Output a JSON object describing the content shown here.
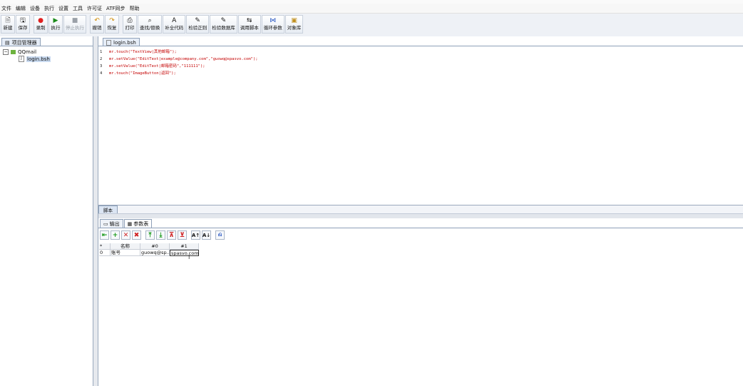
{
  "menu": [
    "文件",
    "编辑",
    "设备",
    "执行",
    "设置",
    "工具",
    "许可证",
    "ATF同步",
    "帮助"
  ],
  "toolbar": [
    {
      "label": "新建",
      "icon": "new-file-icon",
      "glyph": "🗎",
      "enabled": true
    },
    {
      "label": "保存",
      "icon": "save-icon",
      "glyph": "🖫",
      "enabled": true
    },
    {
      "label": "录制",
      "icon": "record-icon",
      "glyph": "●",
      "color": "#e02020",
      "enabled": true
    },
    {
      "label": "执行",
      "icon": "run-icon",
      "glyph": "▶",
      "color": "#1a8a1a",
      "enabled": true
    },
    {
      "label": "停止执行",
      "icon": "stop-icon",
      "glyph": "■",
      "enabled": false
    },
    {
      "label": "撤销",
      "icon": "undo-icon",
      "glyph": "↶",
      "color": "#d08a00",
      "enabled": true
    },
    {
      "label": "恢复",
      "icon": "redo-icon",
      "glyph": "↷",
      "color": "#d08a00",
      "enabled": true
    },
    {
      "label": "打印",
      "icon": "print-icon",
      "glyph": "⎙",
      "enabled": true
    },
    {
      "label": "查找/替换",
      "icon": "find-replace-icon",
      "glyph": "⌕",
      "enabled": true
    },
    {
      "label": "补全代码",
      "icon": "code-complete-icon",
      "glyph": "A",
      "enabled": true
    },
    {
      "label": "检验正则",
      "icon": "regex-check-icon",
      "glyph": "✎",
      "enabled": true
    },
    {
      "label": "检验数据库",
      "icon": "db-check-icon",
      "glyph": "✎",
      "enabled": true
    },
    {
      "label": "调用脚本",
      "icon": "call-script-icon",
      "glyph": "⇆",
      "enabled": true
    },
    {
      "label": "循环参数",
      "icon": "loop-param-icon",
      "glyph": "⋈",
      "color": "#2050c0",
      "enabled": true
    },
    {
      "label": "对象库",
      "icon": "object-lib-icon",
      "glyph": "▣",
      "color": "#c09020",
      "enabled": true
    }
  ],
  "left_panel": {
    "tab_label": "项目管理器",
    "tree": {
      "root": "QQmail",
      "child": "login.bsh"
    }
  },
  "editor": {
    "tab_label": "login.bsh",
    "line_numbers": [
      "1",
      "2",
      "3",
      "4"
    ],
    "lines": [
      "mr.touch(\"TextView|其他邮箱\");",
      "mr.setValue(\"EditText|example@company.com\",\"guowq@spasvo.com\");",
      "mr.setValue(\"EditText|邮箱密码\",\"111111\");",
      "mr.touch(\"ImageButton|返回\");"
    ],
    "bottom_tab": "脚本"
  },
  "bottom_panel": {
    "tabs": [
      "输出",
      "参数表"
    ],
    "active_tab": "参数表",
    "table": {
      "headers": [
        "*",
        "名称",
        "#0",
        "#1"
      ],
      "rows": [
        [
          "0",
          "账号",
          "guowq@sp...",
          "spasvo.com"
        ]
      ]
    },
    "cursor_glyph": "I"
  }
}
